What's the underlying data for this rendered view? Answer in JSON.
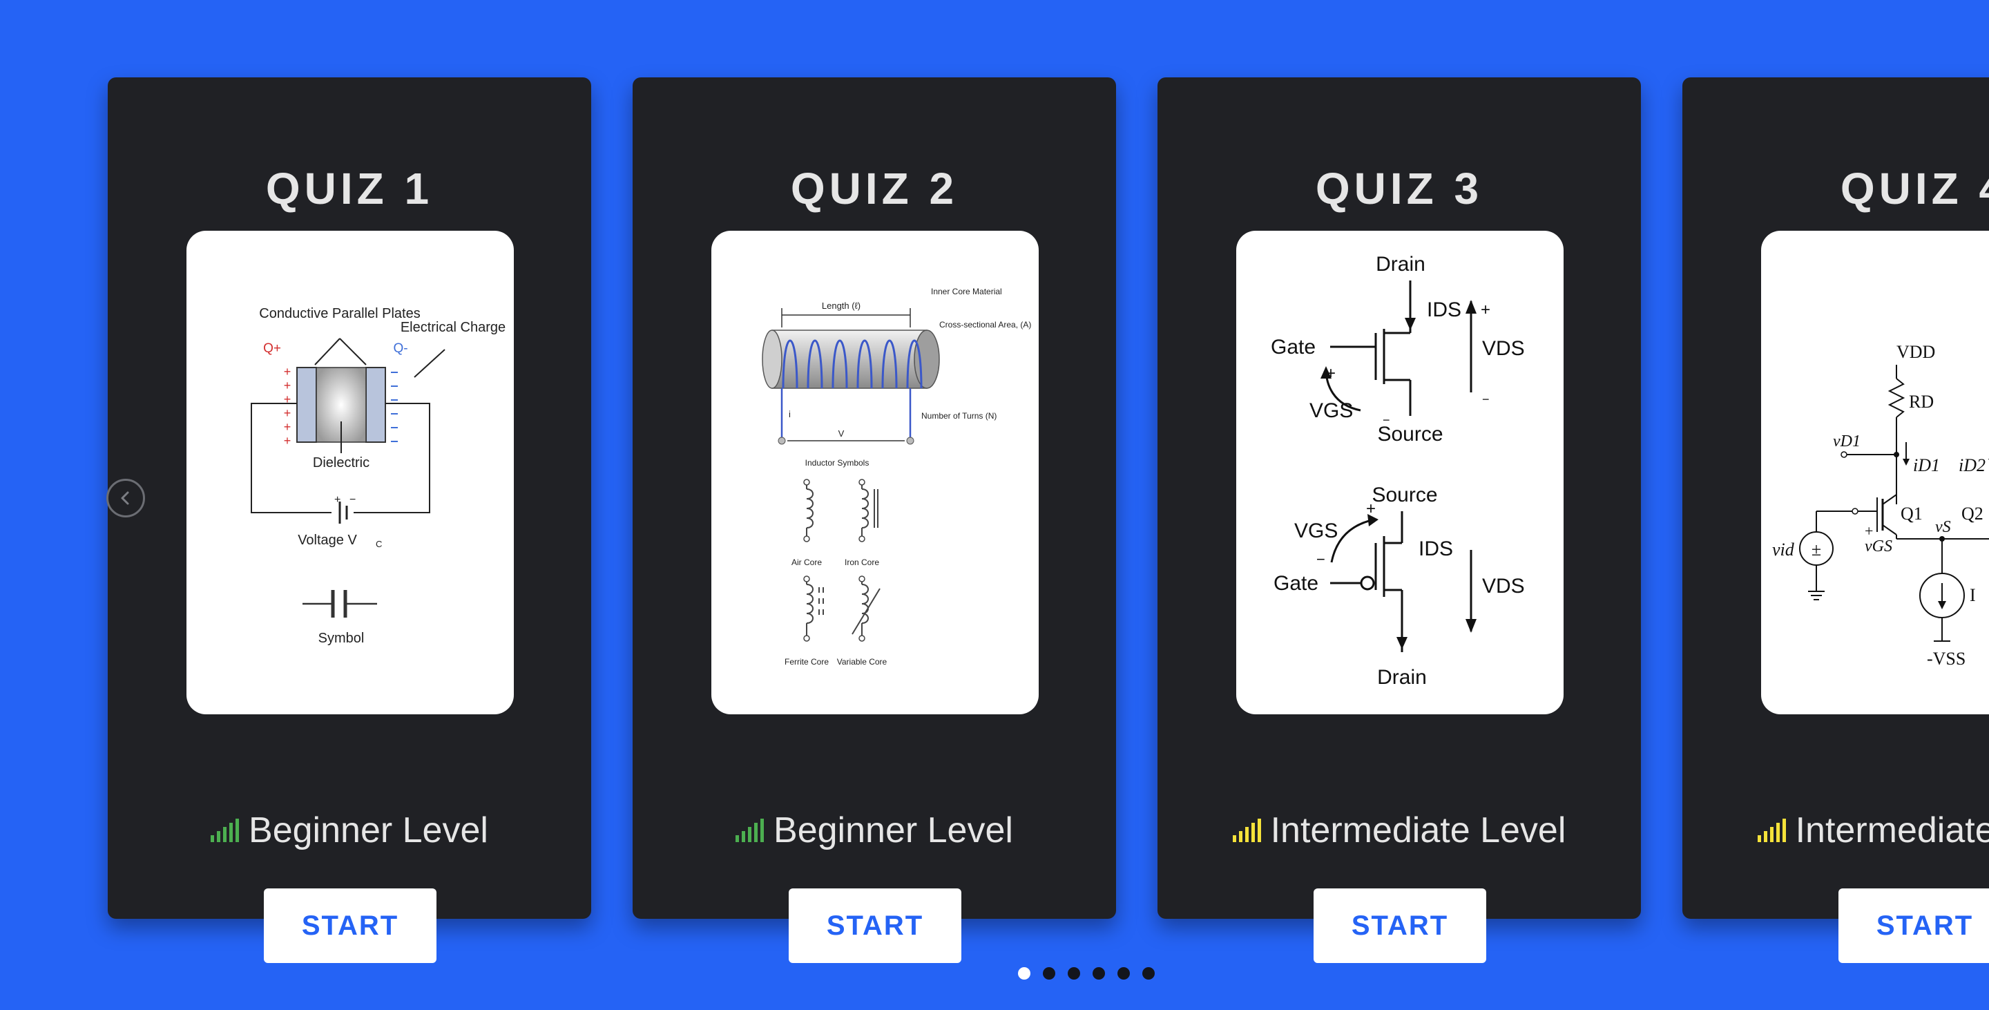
{
  "quizzes": [
    {
      "title": "QUIZ 1",
      "level": "Beginner Level",
      "level_color": "#4caf50",
      "start": "START",
      "image": "capacitor-diagram",
      "labels": {
        "plates": "Conductive Parallel Plates",
        "charge": "Electrical Charge",
        "qplus": "Q+",
        "qminus": "Q-",
        "dielectric": "Dielectric",
        "voltage": "Voltage V",
        "voltage_sub": "C",
        "symbol": "Symbol"
      }
    },
    {
      "title": "QUIZ 2",
      "level": "Beginner Level",
      "level_color": "#4caf50",
      "start": "START",
      "image": "inductor-diagram",
      "labels": {
        "length": "Length (ℓ)",
        "inner": "Inner Core Material",
        "cross": "Cross-sectional Area, (A)",
        "turns": "Number of Turns (N)",
        "i": "i",
        "v": "V",
        "symbols": "Inductor Symbols",
        "air": "Air Core",
        "iron": "Iron Core",
        "ferrite": "Ferrite Core",
        "variable": "Variable Core"
      }
    },
    {
      "title": "QUIZ 3",
      "level": "Intermediate Level",
      "level_color": "#f5e23a",
      "start": "START",
      "image": "mosfet-diagram",
      "labels": {
        "drain": "Drain",
        "gate": "Gate",
        "source": "Source",
        "ids": "IDS",
        "vds": "VDS",
        "vgs": "VGS"
      }
    },
    {
      "title": "QUIZ 4",
      "level": "Intermediate Level",
      "level_color": "#f5e23a",
      "start": "START",
      "image": "differential-pair-diagram",
      "labels": {
        "vdd": "VDD",
        "rd": "RD",
        "vd1": "vD1",
        "id1": "iD1",
        "id2": "iD2",
        "q1": "Q1",
        "q2": "Q2",
        "vs": "vS",
        "vid": "vid",
        "vgs": "vGS",
        "i": "I",
        "vss": "-VSS"
      }
    }
  ],
  "navigation": {
    "prev_icon": "chevron-left-icon",
    "dots": 6,
    "active_dot": 0
  }
}
